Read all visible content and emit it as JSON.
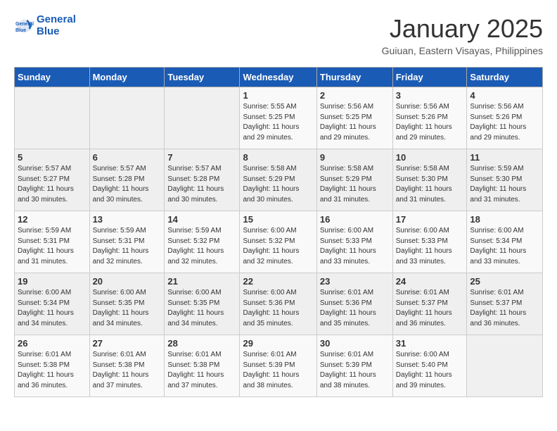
{
  "header": {
    "logo_line1": "General",
    "logo_line2": "Blue",
    "month": "January 2025",
    "location": "Guiuan, Eastern Visayas, Philippines"
  },
  "weekdays": [
    "Sunday",
    "Monday",
    "Tuesday",
    "Wednesday",
    "Thursday",
    "Friday",
    "Saturday"
  ],
  "weeks": [
    [
      {
        "day": "",
        "info": ""
      },
      {
        "day": "",
        "info": ""
      },
      {
        "day": "",
        "info": ""
      },
      {
        "day": "1",
        "info": "Sunrise: 5:55 AM\nSunset: 5:25 PM\nDaylight: 11 hours\nand 29 minutes."
      },
      {
        "day": "2",
        "info": "Sunrise: 5:56 AM\nSunset: 5:25 PM\nDaylight: 11 hours\nand 29 minutes."
      },
      {
        "day": "3",
        "info": "Sunrise: 5:56 AM\nSunset: 5:26 PM\nDaylight: 11 hours\nand 29 minutes."
      },
      {
        "day": "4",
        "info": "Sunrise: 5:56 AM\nSunset: 5:26 PM\nDaylight: 11 hours\nand 29 minutes."
      }
    ],
    [
      {
        "day": "5",
        "info": "Sunrise: 5:57 AM\nSunset: 5:27 PM\nDaylight: 11 hours\nand 30 minutes."
      },
      {
        "day": "6",
        "info": "Sunrise: 5:57 AM\nSunset: 5:28 PM\nDaylight: 11 hours\nand 30 minutes."
      },
      {
        "day": "7",
        "info": "Sunrise: 5:57 AM\nSunset: 5:28 PM\nDaylight: 11 hours\nand 30 minutes."
      },
      {
        "day": "8",
        "info": "Sunrise: 5:58 AM\nSunset: 5:29 PM\nDaylight: 11 hours\nand 30 minutes."
      },
      {
        "day": "9",
        "info": "Sunrise: 5:58 AM\nSunset: 5:29 PM\nDaylight: 11 hours\nand 31 minutes."
      },
      {
        "day": "10",
        "info": "Sunrise: 5:58 AM\nSunset: 5:30 PM\nDaylight: 11 hours\nand 31 minutes."
      },
      {
        "day": "11",
        "info": "Sunrise: 5:59 AM\nSunset: 5:30 PM\nDaylight: 11 hours\nand 31 minutes."
      }
    ],
    [
      {
        "day": "12",
        "info": "Sunrise: 5:59 AM\nSunset: 5:31 PM\nDaylight: 11 hours\nand 31 minutes."
      },
      {
        "day": "13",
        "info": "Sunrise: 5:59 AM\nSunset: 5:31 PM\nDaylight: 11 hours\nand 32 minutes."
      },
      {
        "day": "14",
        "info": "Sunrise: 5:59 AM\nSunset: 5:32 PM\nDaylight: 11 hours\nand 32 minutes."
      },
      {
        "day": "15",
        "info": "Sunrise: 6:00 AM\nSunset: 5:32 PM\nDaylight: 11 hours\nand 32 minutes."
      },
      {
        "day": "16",
        "info": "Sunrise: 6:00 AM\nSunset: 5:33 PM\nDaylight: 11 hours\nand 33 minutes."
      },
      {
        "day": "17",
        "info": "Sunrise: 6:00 AM\nSunset: 5:33 PM\nDaylight: 11 hours\nand 33 minutes."
      },
      {
        "day": "18",
        "info": "Sunrise: 6:00 AM\nSunset: 5:34 PM\nDaylight: 11 hours\nand 33 minutes."
      }
    ],
    [
      {
        "day": "19",
        "info": "Sunrise: 6:00 AM\nSunset: 5:34 PM\nDaylight: 11 hours\nand 34 minutes."
      },
      {
        "day": "20",
        "info": "Sunrise: 6:00 AM\nSunset: 5:35 PM\nDaylight: 11 hours\nand 34 minutes."
      },
      {
        "day": "21",
        "info": "Sunrise: 6:00 AM\nSunset: 5:35 PM\nDaylight: 11 hours\nand 34 minutes."
      },
      {
        "day": "22",
        "info": "Sunrise: 6:00 AM\nSunset: 5:36 PM\nDaylight: 11 hours\nand 35 minutes."
      },
      {
        "day": "23",
        "info": "Sunrise: 6:01 AM\nSunset: 5:36 PM\nDaylight: 11 hours\nand 35 minutes."
      },
      {
        "day": "24",
        "info": "Sunrise: 6:01 AM\nSunset: 5:37 PM\nDaylight: 11 hours\nand 36 minutes."
      },
      {
        "day": "25",
        "info": "Sunrise: 6:01 AM\nSunset: 5:37 PM\nDaylight: 11 hours\nand 36 minutes."
      }
    ],
    [
      {
        "day": "26",
        "info": "Sunrise: 6:01 AM\nSunset: 5:38 PM\nDaylight: 11 hours\nand 36 minutes."
      },
      {
        "day": "27",
        "info": "Sunrise: 6:01 AM\nSunset: 5:38 PM\nDaylight: 11 hours\nand 37 minutes."
      },
      {
        "day": "28",
        "info": "Sunrise: 6:01 AM\nSunset: 5:38 PM\nDaylight: 11 hours\nand 37 minutes."
      },
      {
        "day": "29",
        "info": "Sunrise: 6:01 AM\nSunset: 5:39 PM\nDaylight: 11 hours\nand 38 minutes."
      },
      {
        "day": "30",
        "info": "Sunrise: 6:01 AM\nSunset: 5:39 PM\nDaylight: 11 hours\nand 38 minutes."
      },
      {
        "day": "31",
        "info": "Sunrise: 6:00 AM\nSunset: 5:40 PM\nDaylight: 11 hours\nand 39 minutes."
      },
      {
        "day": "",
        "info": ""
      }
    ]
  ]
}
